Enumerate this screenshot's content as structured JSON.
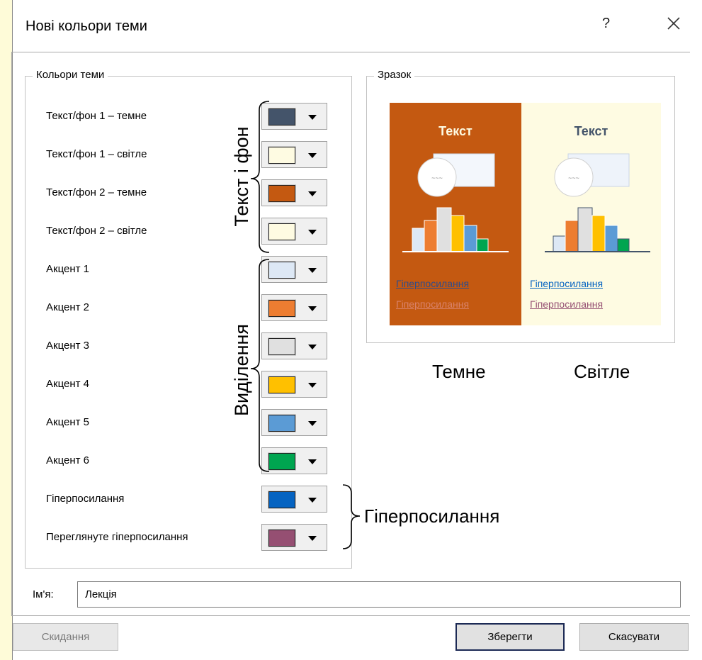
{
  "dialog": {
    "title": "Нові кольори теми",
    "help_label": "?",
    "close_label": "✕"
  },
  "theme_colors": {
    "caption": "Кольори теми",
    "rows": [
      {
        "label": "Текст/фон 1 – темне",
        "color": "#44546a"
      },
      {
        "label": "Текст/фон 1 – світле",
        "color": "#fefbe2"
      },
      {
        "label": "Текст/фон 2 – темне",
        "color": "#c45911"
      },
      {
        "label": "Текст/фон 2 – світле",
        "color": "#fefbe2"
      },
      {
        "label": "Акцент 1",
        "color": "#dde8f5"
      },
      {
        "label": "Акцент 2",
        "color": "#ed7d31"
      },
      {
        "label": "Акцент 3",
        "color": "#e0e0e0"
      },
      {
        "label": "Акцент 4",
        "color": "#ffc000"
      },
      {
        "label": "Акцент 5",
        "color": "#5b9bd5"
      },
      {
        "label": "Акцент 6",
        "color": "#00a550"
      },
      {
        "label": "Гіперпосилання",
        "color": "#0563c1"
      },
      {
        "label": "Переглянуте гіперпосилання",
        "color": "#954f72"
      }
    ]
  },
  "annotations": {
    "text_and_bg": "Текст і фон",
    "accents": "Виділення",
    "hyperlinks": "Гіперпосилання",
    "dark": "Темне",
    "light": "Світле"
  },
  "sample": {
    "caption": "Зразок",
    "dark": {
      "heading": "Текст",
      "link": "Гіперпосилання",
      "visited_link": "Гіперпосилання",
      "bg_color": "#c45911",
      "text_color": "#fefbe2",
      "link_color": "#2f4d8c",
      "visited_color": "#d9826a"
    },
    "light": {
      "heading": "Текст",
      "link": "Гіперпосилання",
      "visited_link": "Гіперпосилання",
      "bg_color": "#fefbe2",
      "text_color": "#44546a",
      "link_color": "#0563c1",
      "visited_color": "#954f72"
    }
  },
  "name_field": {
    "label": "Ім'я:",
    "value": "Лекція"
  },
  "buttons": {
    "reset": "Скидання",
    "save": "Зберегти",
    "cancel": "Скасувати"
  }
}
